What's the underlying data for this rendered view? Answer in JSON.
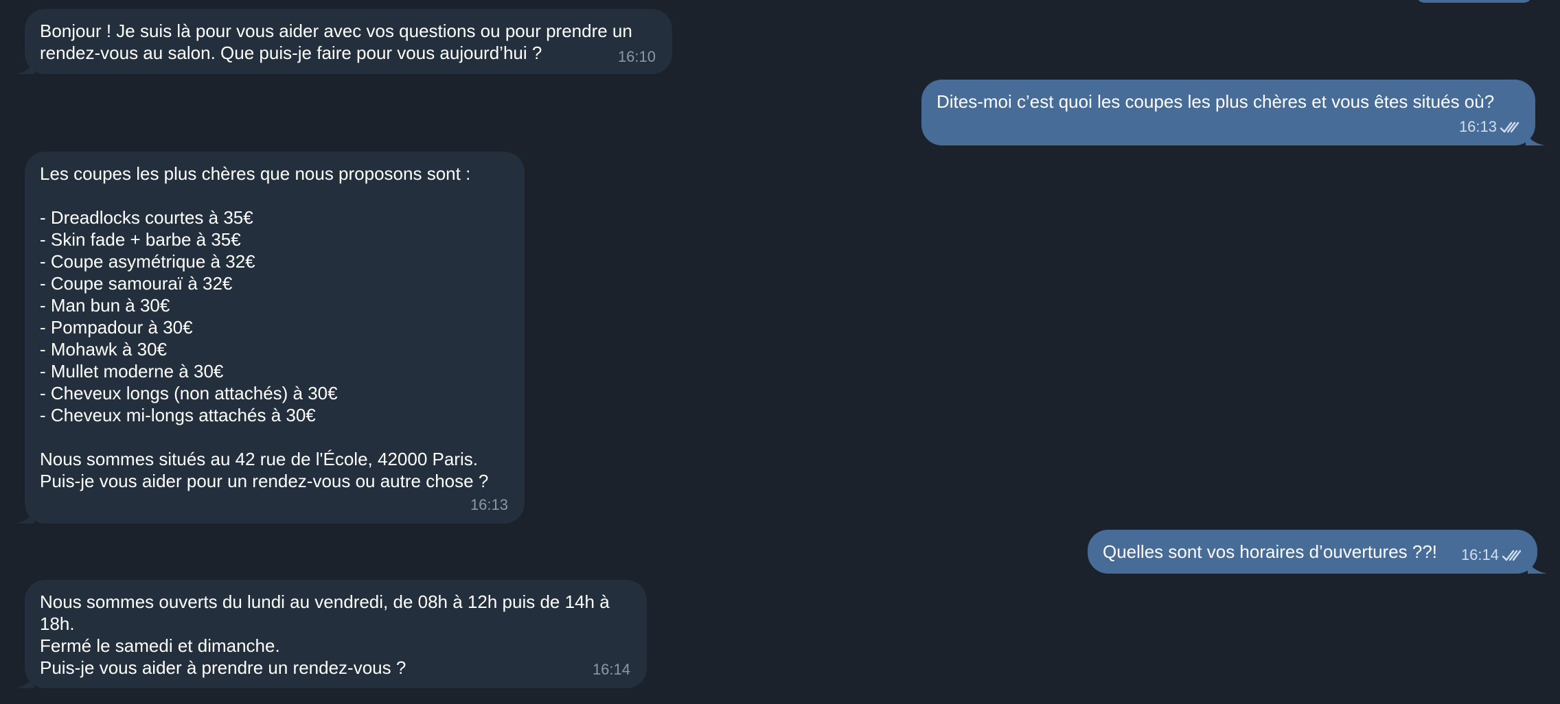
{
  "colors": {
    "background": "#1b222c",
    "incoming_bubble": "#242f3d",
    "outgoing_bubble": "#476c98",
    "incoming_time": "#8b98a6",
    "outgoing_time": "#d2dff0"
  },
  "messages": [
    {
      "direction": "incoming",
      "text": "Bonjour ! Je suis là pour vous aider avec vos questions ou pour prendre un\nrendez-vous au salon. Que puis-je faire pour vous aujourd’hui ?",
      "time": "16:10"
    },
    {
      "direction": "outgoing",
      "text": "Dites-moi c’est quoi les coupes les plus chères et vous êtes situés où?",
      "time": "16:13",
      "status_icon": "double-check-icon"
    },
    {
      "direction": "incoming",
      "text": "Les coupes les plus chères que nous proposons sont :\n\n- Dreadlocks courtes à 35€\n- Skin fade + barbe à 35€\n- Coupe asymétrique à 32€\n- Coupe samouraï à 32€\n- Man bun à 30€\n- Pompadour à 30€\n- Mohawk à 30€\n- Mullet moderne à 30€\n- Cheveux longs (non attachés) à 30€\n- Cheveux mi-longs attachés à 30€\n\nNous sommes situés au 42 rue de l'École, 42000 Paris.\nPuis-je vous aider pour un rendez-vous ou autre chose ?",
      "time": "16:13"
    },
    {
      "direction": "outgoing",
      "text": "Quelles sont vos horaires d’ouvertures ??!",
      "time": "16:14",
      "status_icon": "double-check-icon"
    },
    {
      "direction": "incoming",
      "text": "Nous sommes ouverts du lundi au vendredi, de 08h à 12h puis de 14h à\n18h.\nFermé le samedi et dimanche.\nPuis-je vous aider à prendre un rendez-vous ?",
      "time": "16:14"
    }
  ]
}
